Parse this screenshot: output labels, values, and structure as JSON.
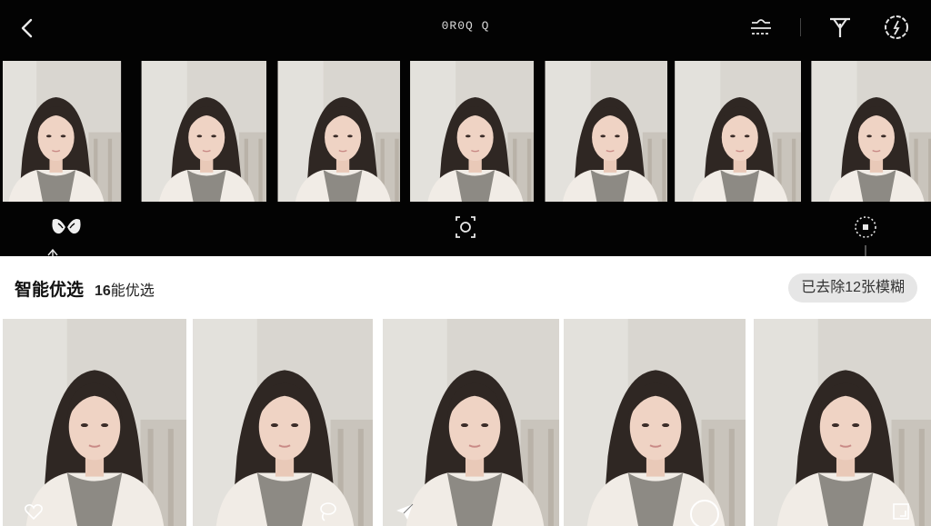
{
  "header": {
    "title": "0R0Q Q",
    "back_icon": "chevron-left-icon",
    "right_icons": [
      "layers-adjust-icon",
      "antenna-filter-icon",
      "compass-icon"
    ]
  },
  "filmstrip": {
    "frame_count": 7,
    "tools": {
      "left": "wings-icon",
      "center": "face-focus-icon",
      "right": "dotted-circle-icon"
    }
  },
  "section": {
    "title": "智能优选",
    "count_number": "16",
    "count_text": "能优选",
    "blur_removed_label": "已去除12张模糊"
  },
  "grid": {
    "photo_count": 5,
    "badges": [
      "heart-outline-icon",
      "lasso-icon",
      "paper-plane-icon",
      "select-circle-icon",
      "expand-corner-icon"
    ]
  },
  "colors": {
    "dark_bg": "#030303",
    "pill_bg": "#e6e6e6",
    "icon": "#e8e8e8"
  }
}
